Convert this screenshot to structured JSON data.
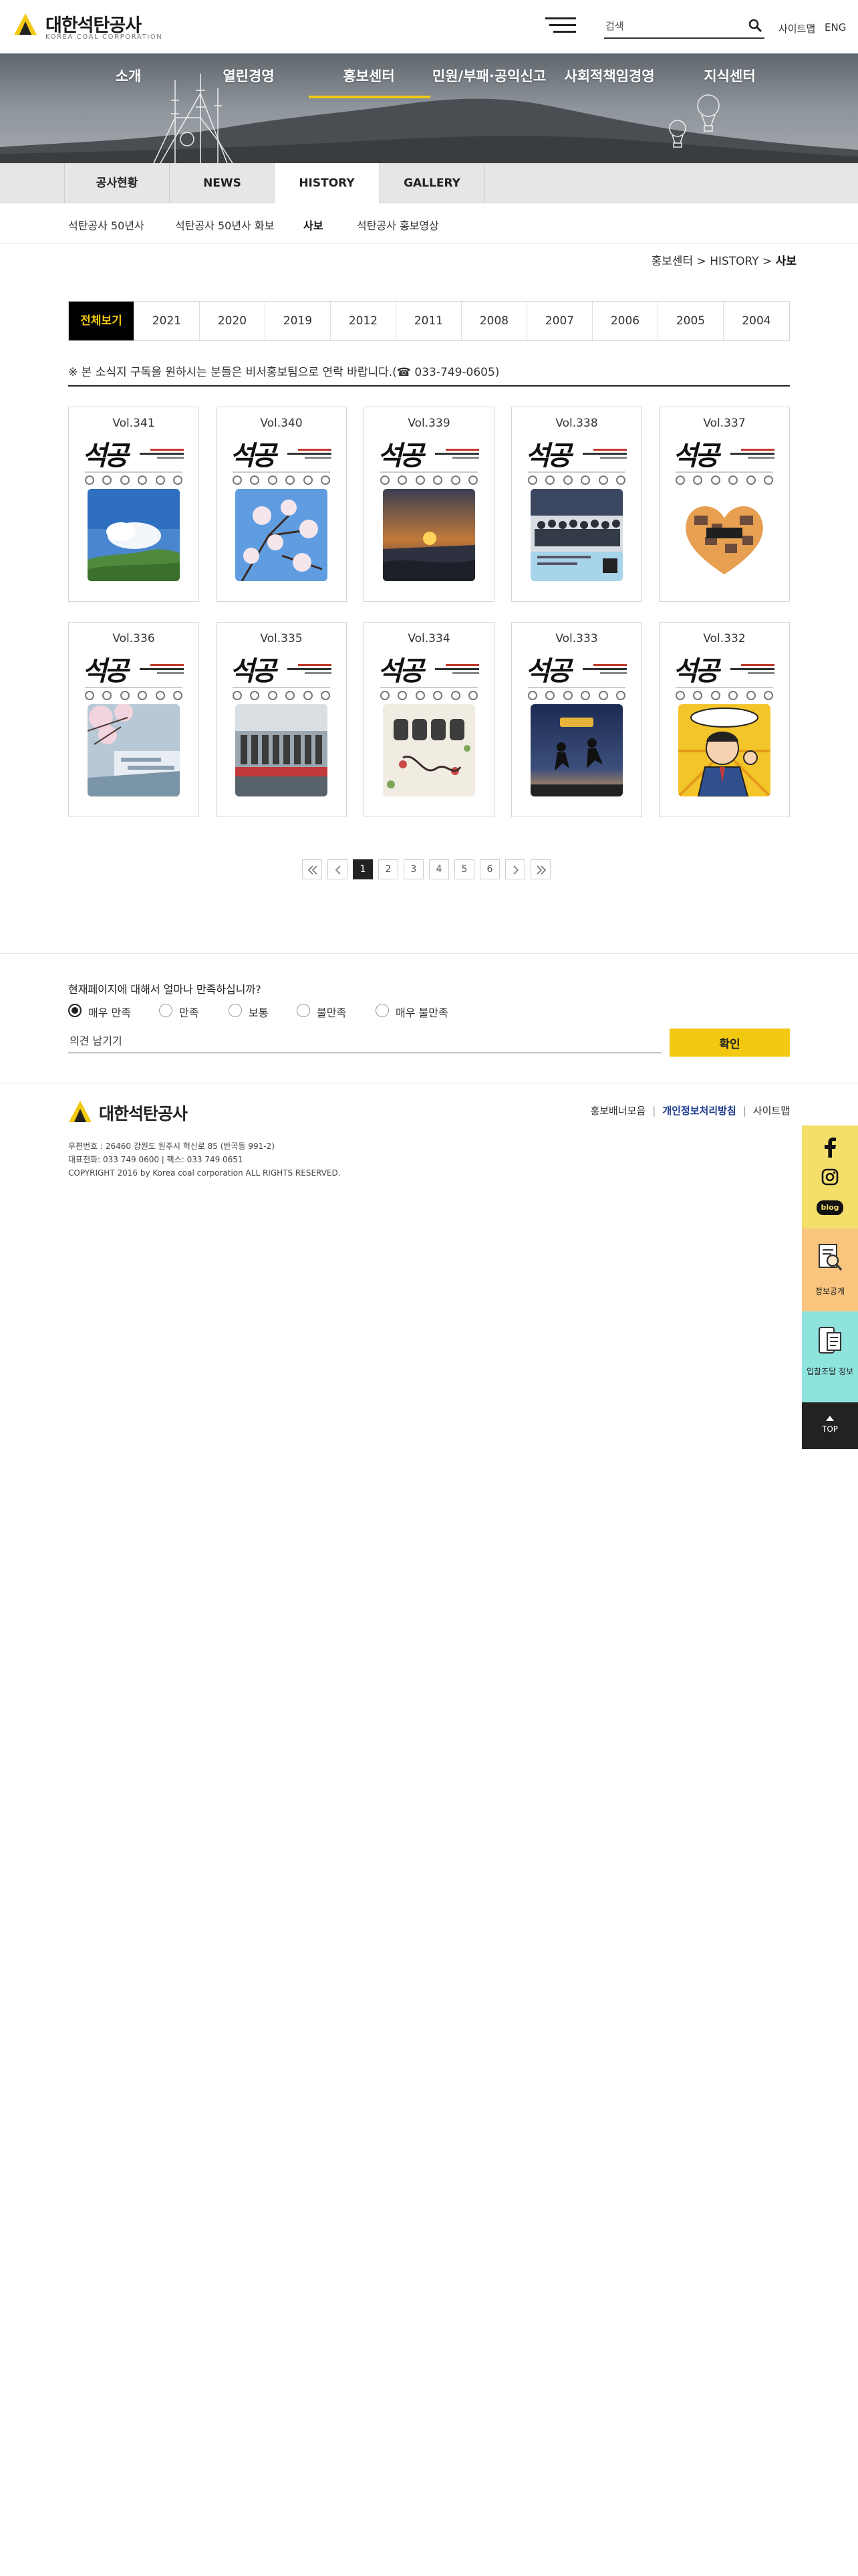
{
  "header": {
    "logo_ko": "대한석탄공사",
    "logo_en": "KOREA COAL CORPORATION",
    "search_placeholder": "검색",
    "sitemap": "사이트맵",
    "lang": "ENG"
  },
  "gnb": [
    {
      "label": "소개"
    },
    {
      "label": "열린경영"
    },
    {
      "label": "홍보센터"
    },
    {
      "label": "민원/부패·공익신고"
    },
    {
      "label": "사회적책임경영"
    },
    {
      "label": "지식센터"
    }
  ],
  "subtabs": [
    {
      "label": "공사현황"
    },
    {
      "label": "NEWS"
    },
    {
      "label": "HISTORY"
    },
    {
      "label": "GALLERY"
    }
  ],
  "subsub": [
    {
      "label": "석탄공사 50년사"
    },
    {
      "label": "석탄공사 50년사 화보"
    },
    {
      "label": "사보"
    },
    {
      "label": "석탄공사 홍보영상"
    }
  ],
  "breadcrumb": {
    "path": "홍보센터 > HISTORY > ",
    "current": "사보"
  },
  "years": [
    "전체보기",
    "2021",
    "2020",
    "2019",
    "2012",
    "2011",
    "2008",
    "2007",
    "2006",
    "2005",
    "2004"
  ],
  "notice": "※ 본 소식지 구독을 원하시는 분들은 비서홍보팀으로 연락 바랍니다.(☎ 033-749-0605)",
  "issues": [
    {
      "vol": "Vol.341",
      "cover": "석공"
    },
    {
      "vol": "Vol.340",
      "cover": "석공"
    },
    {
      "vol": "Vol.339",
      "cover": "석공"
    },
    {
      "vol": "Vol.338",
      "cover": "석공"
    },
    {
      "vol": "Vol.337",
      "cover": "석공"
    },
    {
      "vol": "Vol.336",
      "cover": "석공"
    },
    {
      "vol": "Vol.335",
      "cover": "석공"
    },
    {
      "vol": "Vol.334",
      "cover": "석공"
    },
    {
      "vol": "Vol.333",
      "cover": "석공"
    },
    {
      "vol": "Vol.332",
      "cover": "석공"
    }
  ],
  "pagination": {
    "pages": [
      "1",
      "2",
      "3",
      "4",
      "5",
      "6"
    ],
    "current": "1"
  },
  "survey": {
    "question": "현재페이지에 대해서 얼마나 만족하십니까?",
    "options": [
      "매우 만족",
      "만족",
      "보통",
      "불만족",
      "매우 불만족"
    ],
    "selected": "매우 만족",
    "opinion_placeholder": "의견 남기기",
    "submit": "확인"
  },
  "footer": {
    "logo_ko": "대한석탄공사",
    "links": [
      "홍보배너모음",
      "개인정보처리방침",
      "사이트맵"
    ],
    "address": "우편번호 : 26460 강원도 원주시 혁신로 85 (반곡동 991-2)",
    "phone": "대표전화: 033 749 0600  |  팩스: 033 749 0651",
    "copyright": "COPYRIGHT 2016 by Korea coal corporation ALL RIGHTS RESERVED."
  },
  "quick": {
    "blog": "blog",
    "info": "정보공개",
    "procure": "입찰조달 정보",
    "top": "TOP"
  },
  "colors": {
    "accent": "#f2c811",
    "dark": "#222222",
    "link_highlight": "#1d3b8f"
  }
}
